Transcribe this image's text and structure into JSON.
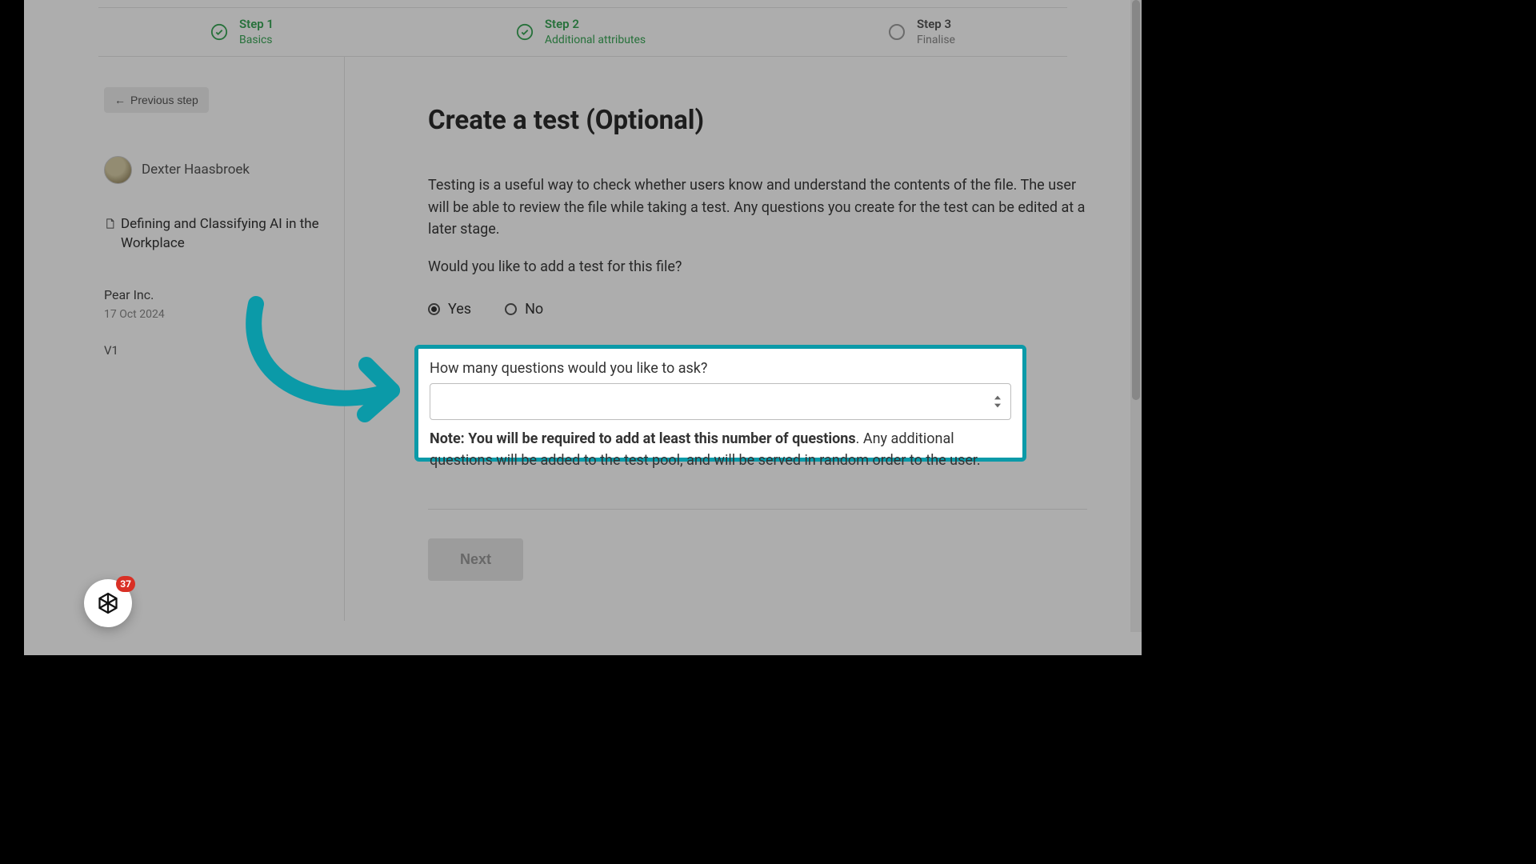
{
  "stepper": {
    "steps": [
      {
        "title": "Step 1",
        "sub": "Basics",
        "state": "done"
      },
      {
        "title": "Step 2",
        "sub": "Additional attributes",
        "state": "done"
      },
      {
        "title": "Step 3",
        "sub": "Finalise",
        "state": "pending"
      }
    ]
  },
  "sidebar": {
    "prev_label": "Previous step",
    "user_name": "Dexter Haasbroek",
    "doc_title": "Defining and Classifying AI in the Workplace",
    "company": "Pear Inc.",
    "date": "17 Oct 2024",
    "version": "V1"
  },
  "main": {
    "heading": "Create a test (Optional)",
    "paragraph": "Testing is a useful way to check whether users know and understand the contents of the file. The user will be able to review the file while taking a test. Any questions you create for the test can be edited at a later stage.",
    "prompt": "Would you like to add a test for this file?",
    "radio_yes": "Yes",
    "radio_no": "No",
    "selected_radio": "yes",
    "field_label": "How many questions would you like to ask?",
    "field_value": "",
    "note_bold": "Note: You will be required to add at least this number of questions",
    "note_rest": ". Any additional questions will be added to the test pool, and will be served in random order to the user.",
    "next_label": "Next"
  },
  "widget": {
    "badge": "37"
  },
  "colors": {
    "accent_green": "#3aa757",
    "highlight_teal": "#0b9aa8",
    "badge_red": "#d93025"
  }
}
